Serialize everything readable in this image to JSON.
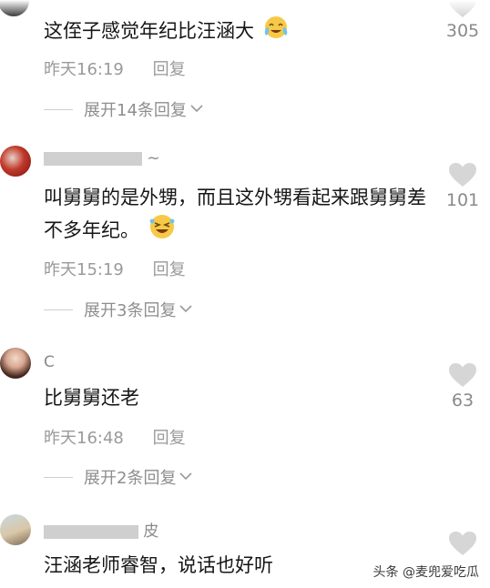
{
  "comments": [
    {
      "username": "",
      "text": "这侄子感觉年纪比汪涵大",
      "emoji": "crying-laugh-emoji",
      "time": "昨天16:19",
      "reply_label": "回复",
      "expand_label": "展开14条回复",
      "likes": "305"
    },
    {
      "username": "~",
      "text": "叫舅舅的是外甥，而且这外甥看起来跟舅舅差不多年纪。",
      "emoji": "rolling-laugh-emoji",
      "time": "昨天15:19",
      "reply_label": "回复",
      "expand_label": "展开3条回复",
      "likes": "101"
    },
    {
      "username": "C",
      "text": "比舅舅还老",
      "time": "昨天16:48",
      "reply_label": "回复",
      "expand_label": "展开2条回复",
      "likes": "63"
    },
    {
      "username": "皮",
      "text": "汪涵老师睿智，说话也好听",
      "likes": ""
    }
  ],
  "watermark": "头条 @麦兜爱吃瓜",
  "icons": {
    "like": "heart-icon",
    "expand": "chevron-down-icon"
  },
  "colors": {
    "text": "#161616",
    "meta": "#9a9a9a",
    "heart": "#d6d6d6"
  }
}
